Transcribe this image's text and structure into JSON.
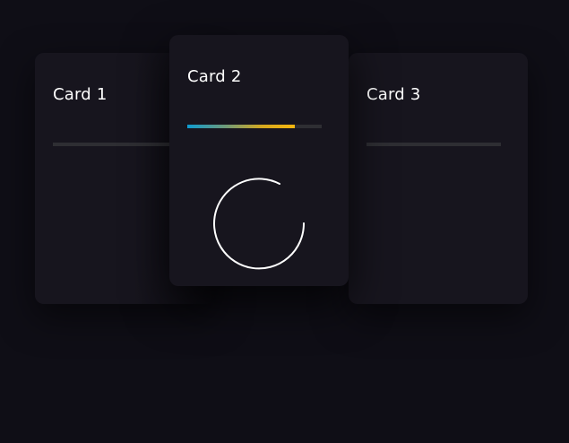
{
  "cards": [
    {
      "title": "Card 1",
      "progress": 0
    },
    {
      "title": "Card 2",
      "progress": 0.8
    },
    {
      "title": "Card 3",
      "progress": 0
    }
  ],
  "colors": {
    "background": "#0f0e16",
    "card": "#17151e",
    "track": "#2e2e33",
    "progress_start": "#0e9bd0",
    "progress_end": "#f5b60f",
    "spinner": "#ffffff"
  },
  "icons": {
    "loading": "loading-spinner-icon"
  }
}
